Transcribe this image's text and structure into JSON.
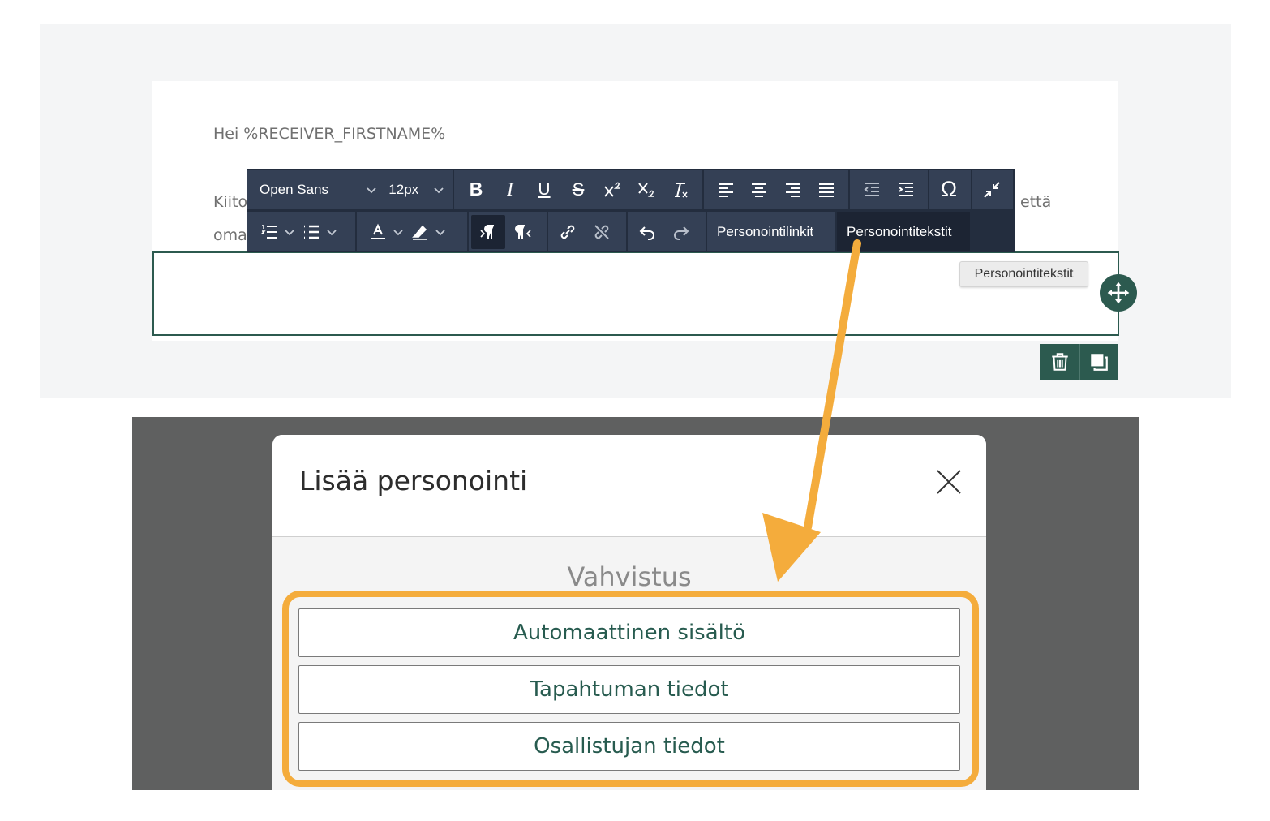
{
  "email": {
    "greeting": "Hei %RECEIVER_FIRSTNAME%",
    "line2_start": "Kiito",
    "line2_end": "että",
    "line3_start": "oma"
  },
  "toolbar": {
    "font_family": "Open Sans",
    "font_size": "12px",
    "buttons": {
      "bold": "B",
      "italic": "I",
      "underline": "U",
      "strikethrough": "S",
      "special_char": "Ω"
    },
    "personalization_links_label": "Personointilinkit",
    "personalization_texts_label": "Personointitekstit"
  },
  "tooltip": {
    "text": "Personointitekstit"
  },
  "modal": {
    "title": "Lisää personointi",
    "section_title": "Vahvistus",
    "options": [
      "Automaattinen sisältö",
      "Tapahtuman tiedot",
      "Osallistujan tiedot"
    ]
  },
  "colors": {
    "brand_green": "#2c5a4f",
    "toolbar_bg": "#232d3e",
    "highlight_orange": "#f4ac3c",
    "overlay_gray": "#5f6060"
  }
}
